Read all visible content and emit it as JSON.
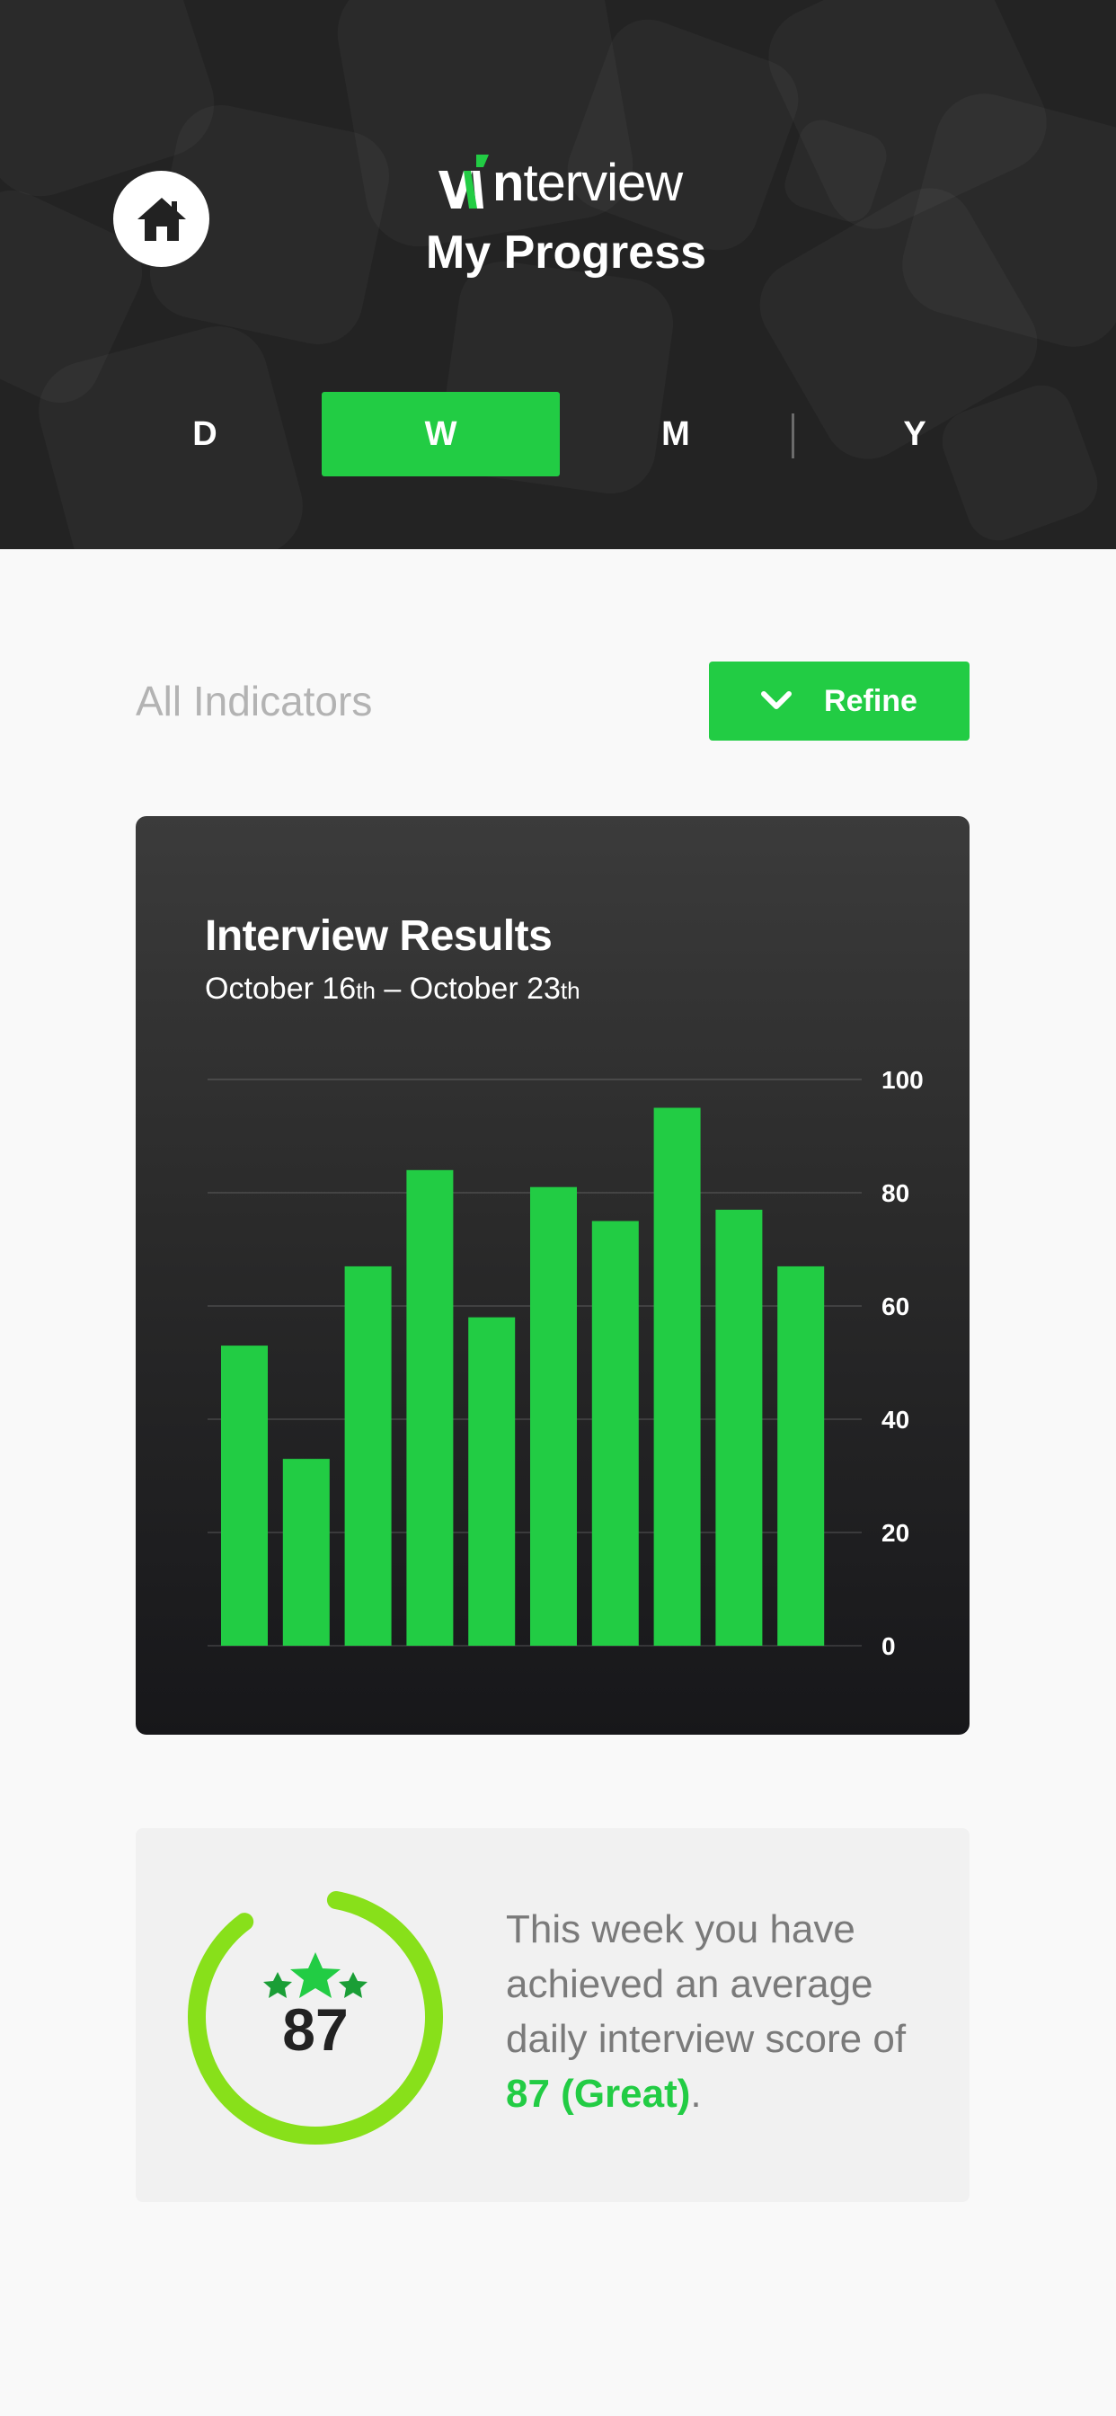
{
  "app": {
    "brand_letter": "w",
    "brand_accent": "i",
    "brand_bold": "n",
    "brand_rest": "terview",
    "title": "My Progress"
  },
  "tabs": [
    {
      "label": "D",
      "active": false
    },
    {
      "label": "W",
      "active": true
    },
    {
      "label": "M",
      "active": false
    },
    {
      "label": "Y",
      "active": false
    }
  ],
  "filter": {
    "label": "All Indicators",
    "refine_label": "Refine"
  },
  "chart_data": {
    "type": "bar",
    "title": "Interview Results",
    "subtitle_parts": [
      "October 16",
      "th",
      " – October 23",
      "th"
    ],
    "values": [
      53,
      33,
      67,
      84,
      58,
      81,
      75,
      95,
      77,
      67
    ],
    "ylim": [
      0,
      100
    ],
    "yticks": [
      "0",
      "20",
      "40",
      "60",
      "80",
      "100"
    ],
    "grid": true,
    "bar_color": "#22cc44"
  },
  "summary": {
    "score": "87",
    "score_fraction": 0.87,
    "text_before": "This week you have achieved an average daily interview score of ",
    "highlight": "87 (Great)",
    "text_after": "."
  },
  "colors": {
    "accent": "#22cc44",
    "gauge": "#88e01a",
    "header_bg": "#232323"
  },
  "icons": {
    "home": "house-icon",
    "refine": "chevron-down-icon",
    "stars": "three-stars-icon"
  }
}
